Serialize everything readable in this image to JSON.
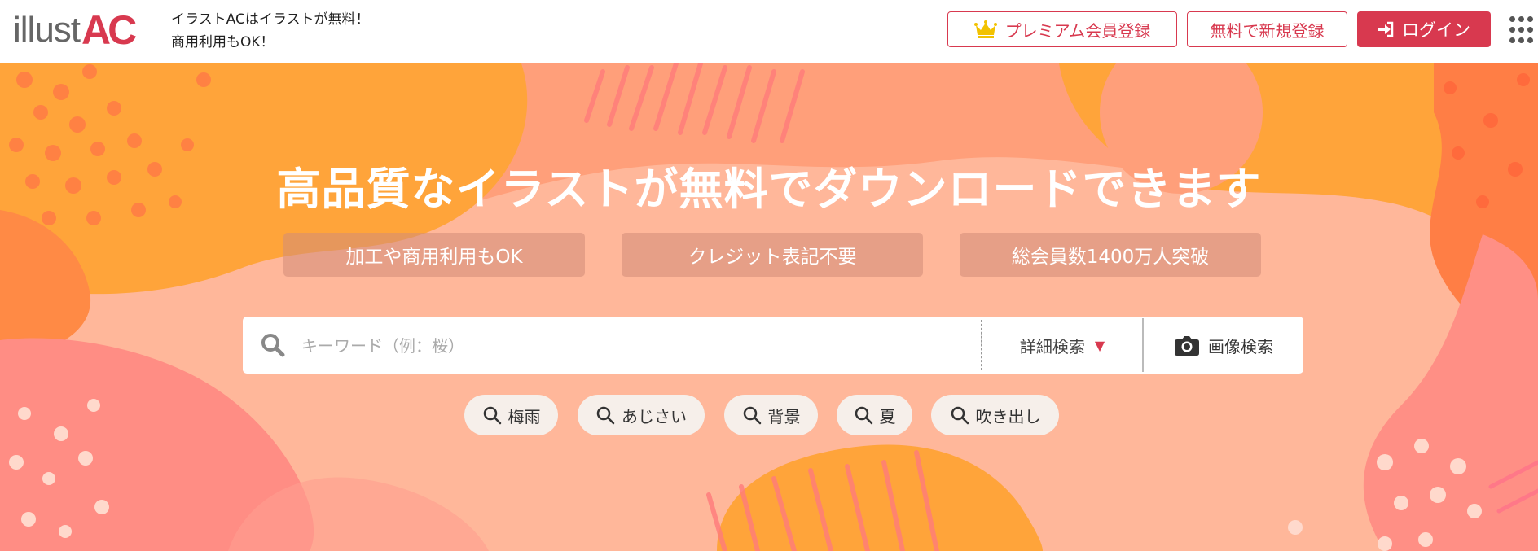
{
  "header": {
    "logo_text": "illust",
    "logo_accent": "AC",
    "tagline_line1": "イラストACはイラストが無料！",
    "tagline_line2": "商用利用もOK！",
    "premium_label": "プレミアム会員登録",
    "register_label": "無料で新規登録",
    "login_label": "ログイン"
  },
  "hero": {
    "headline": "高品質なイラストが無料でダウンロードできます",
    "features": [
      "加工や商用利用もOK",
      "クレジット表記不要",
      "総会員数1400万人突破"
    ]
  },
  "search": {
    "placeholder": "キーワード（例：桜）",
    "advanced_label": "詳細検索",
    "image_search_label": "画像検索"
  },
  "popular_tags": [
    "梅雨",
    "あじさい",
    "背景",
    "夏",
    "吹き出し"
  ],
  "colors": {
    "brand": "#d8394f",
    "hero_base": "#ffb79a",
    "crown": "#f2c200"
  },
  "icons": {
    "premium": "crown-icon",
    "login": "sign-in-icon",
    "menu": "grid-menu-icon",
    "search": "search-icon",
    "advanced": "triangle-down-icon",
    "image_search": "camera-icon",
    "tag": "search-icon"
  }
}
